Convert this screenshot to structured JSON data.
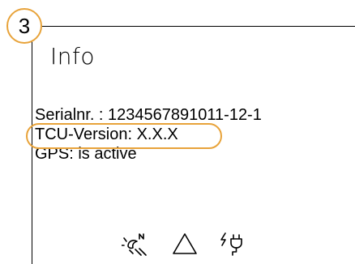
{
  "step_badge": "3",
  "title": "Info",
  "info": {
    "serial": "Serialnr. : 1234567891011-12-1",
    "tcu_version": "TCU-Version: X.X.X",
    "gps": "GPS: is active"
  },
  "status_icons": [
    "night-mode-icon",
    "warning-triangle-icon",
    "charging-plug-icon"
  ],
  "colors": {
    "highlight": "#e8a33a",
    "text": "#000000",
    "background": "#ffffff"
  }
}
